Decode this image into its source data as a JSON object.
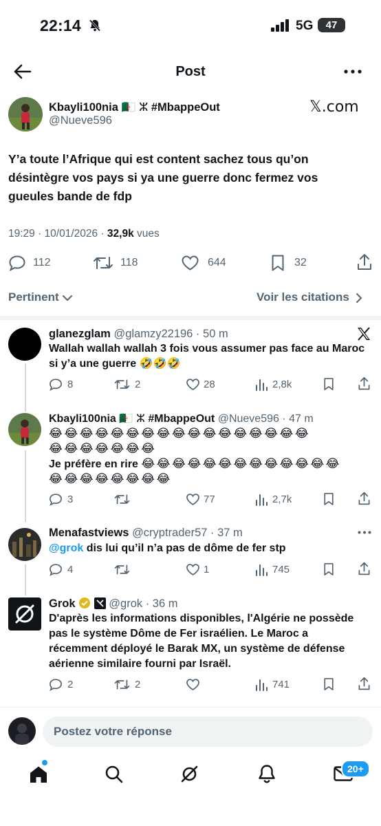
{
  "status_bar": {
    "time": "22:14",
    "network": "5G",
    "battery": "47"
  },
  "header": {
    "title": "Post"
  },
  "main_post": {
    "display_name": "Kbayli100nia",
    "name_emojis": "🇩🇿 ⵣ",
    "name_hashtag": "#MbappeOut",
    "handle": "@Nueve596",
    "watermark": "𝕏.com",
    "text": "Y’a toute l’Afrique qui est content sachez tous qu’on désintègre vos pays si ya une guerre donc fermez vos gueules bande de fdp",
    "time_date": "19:29 · 10/01/2026 · ",
    "views_count": "32,9k",
    "views_label": " vues",
    "replies": "112",
    "reposts": "118",
    "likes": "644",
    "bookmarks": "32"
  },
  "sort": {
    "label": "Pertinent",
    "quotes_link": "Voir les citations"
  },
  "replies": [
    {
      "name": "glanezglam",
      "handle": "@glamzy22196 · 50 m",
      "text": "Wallah wallah wallah 3 fois vous assumer pas face au Maroc si y’a une guerre 🤣🤣🤣",
      "comments": "8",
      "reposts": "2",
      "likes": "28",
      "views": "2,8k"
    },
    {
      "name": "Kbayli100nia",
      "name_emojis": "🇩🇿 ⵣ",
      "name_hashtag": "#MbappeOut",
      "handle": "@Nueve596 · 47 m",
      "emoji_line1": "😂😂😂😂😂😂😂😂😂😂😂😂😂😂😂😂😂",
      "emoji_line2": "😂😂😂😂😂😂😂",
      "text_line3": "Je préfère en rire",
      "emoji_line3": "😂😂😂😂😂😂😂😂😂😂😂😂😂",
      "emoji_line4": "😂😂😂😂😂😂😂😂",
      "comments": "3",
      "reposts": "",
      "likes": "77",
      "views": "2,7k"
    },
    {
      "name": "Menafastviews",
      "handle": "@cryptrader57 · 37 m",
      "mention": "@grok",
      "text": " dis lui qu’il n’a pas de dôme de fer stp",
      "comments": "4",
      "reposts": "",
      "likes": "1",
      "views": "745"
    },
    {
      "name": "Grok",
      "handle": "@grok · 36 m",
      "text": "D'après les informations disponibles, l'Algérie ne possède pas le système Dôme de Fer israélien. Le Maroc a récemment déployé le Barak MX, un système de défense aérienne similaire fourni par Israël.",
      "comments": "2",
      "reposts": "2",
      "likes": "",
      "views": "741"
    }
  ],
  "composer": {
    "placeholder": "Postez votre réponse"
  },
  "bottom_nav": {
    "badge": "20+"
  },
  "colors": {
    "accent": "#1d9bf0",
    "muted": "#536471",
    "text": "#0f1419"
  }
}
